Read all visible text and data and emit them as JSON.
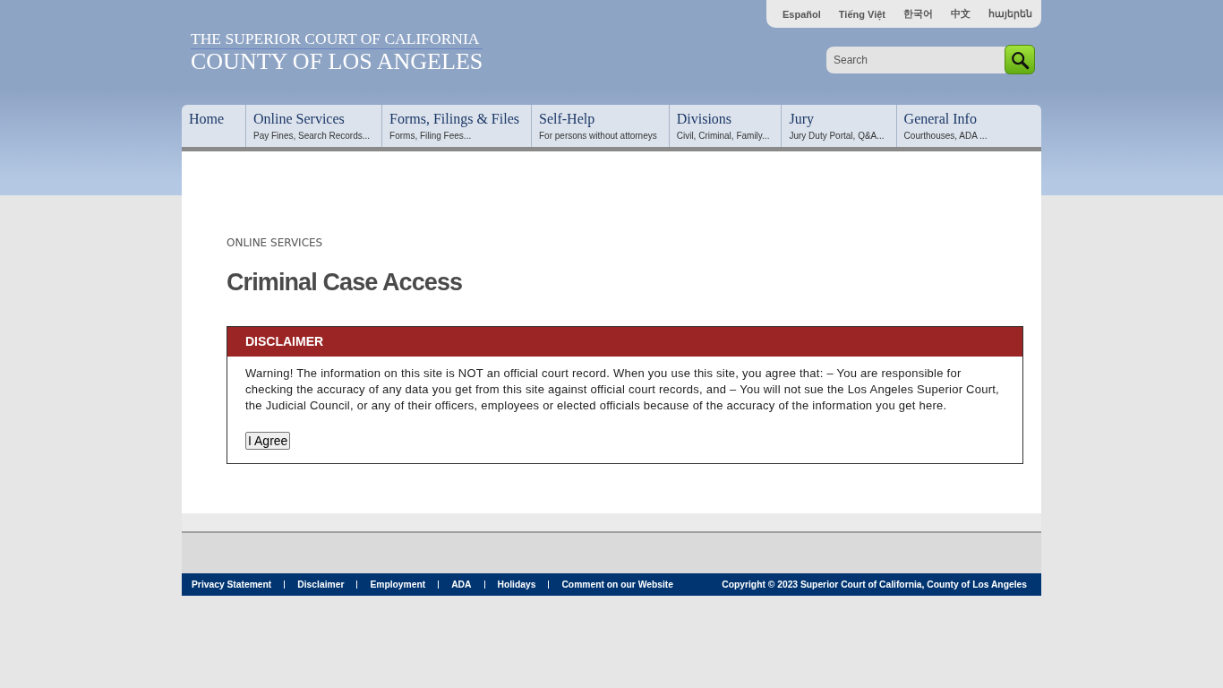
{
  "languages": [
    {
      "label": "Español"
    },
    {
      "label": "Tiếng Việt"
    },
    {
      "label": "한국어"
    },
    {
      "label": "中文"
    },
    {
      "label": "հայերեն"
    }
  ],
  "logo": {
    "line_1": "THE SUPERIOR COURT OF CALIFORNIA",
    "line_2": "COUNTY OF LOS ANGELES"
  },
  "search": {
    "placeholder": "Search"
  },
  "nav": [
    {
      "label": "Home"
    },
    {
      "label": "Online Services",
      "subtitle": "Pay Fines, Search Records..."
    },
    {
      "label": "Forms, Filings & Files",
      "subtitle": "Forms, Filing Fees..."
    },
    {
      "label": "Self-Help",
      "subtitle": "For persons without attorneys"
    },
    {
      "label": "Divisions",
      "subtitle": "Civil, Criminal, Family..."
    },
    {
      "label": "Jury",
      "subtitle": "Jury Duty Portal, Q&A..."
    },
    {
      "label": "General Info",
      "subtitle": "Courthouses, ADA ..."
    }
  ],
  "page": {
    "section": "ONLINE SERVICES",
    "title": "Criminal Case Access"
  },
  "disclaimer": {
    "heading": "DISCLAIMER",
    "text": "Warning! The information on this site is NOT an official court record. When you use this site, you agree that: – You are responsible for checking the accuracy of any data you get from this site against official court records, and – You will not sue the Los Angeles Superior Court, the Judicial Council, or any of their officers, employees or elected officials because of the accuracy of the information you get here.",
    "button": "I Agree"
  },
  "footer": {
    "links": [
      "Privacy Statement",
      "Disclaimer",
      "Employment",
      "ADA",
      "Holidays",
      "Comment on our Website"
    ],
    "copyright": "Copyright © 2023 Superior Court of California, County of Los Angeles"
  }
}
